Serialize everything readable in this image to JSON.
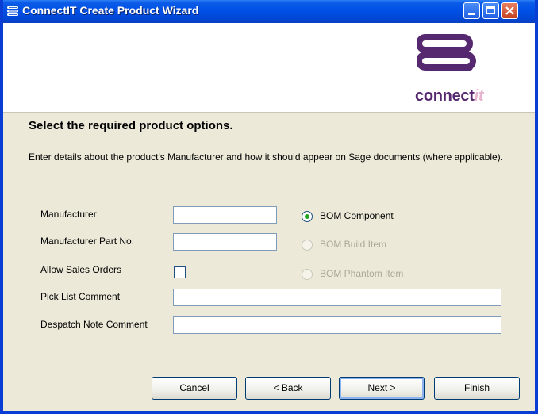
{
  "window": {
    "title": "ConnectIT Create Product Wizard",
    "controls": [
      "minimize-icon",
      "maximize-icon",
      "close-icon"
    ]
  },
  "header": {
    "logo_text_main": "connect",
    "logo_text_accent": "it",
    "logo_color": "#55286f",
    "logo_accent_color": "#e8b4cf"
  },
  "content": {
    "heading": "Select the required product options.",
    "description": "Enter details about the product's Manufacturer and how it should appear on Sage documents (where applicable)."
  },
  "form": {
    "manufacturer_label": "Manufacturer",
    "manufacturer_value": "",
    "part_no_label": "Manufacturer Part No.",
    "part_no_value": "",
    "allow_sales_orders_label": "Allow Sales Orders",
    "allow_sales_orders_checked": false,
    "pick_list_label": "Pick List Comment",
    "pick_list_value": "",
    "despatch_note_label": "Despatch Note Comment",
    "despatch_note_value": ""
  },
  "bom_options": [
    {
      "label": "BOM Component",
      "selected": true,
      "enabled": true
    },
    {
      "label": "BOM Build Item",
      "selected": false,
      "enabled": false
    },
    {
      "label": "BOM Phantom Item",
      "selected": false,
      "enabled": false
    }
  ],
  "buttons": {
    "cancel": "Cancel",
    "back": "< Back",
    "next": "Next >",
    "finish": "Finish"
  },
  "colors": {
    "titlebar": "#0050e6",
    "window_bg": "#ece9d8",
    "radio_selected": "#21a121",
    "disabled_text": "#aca899"
  }
}
